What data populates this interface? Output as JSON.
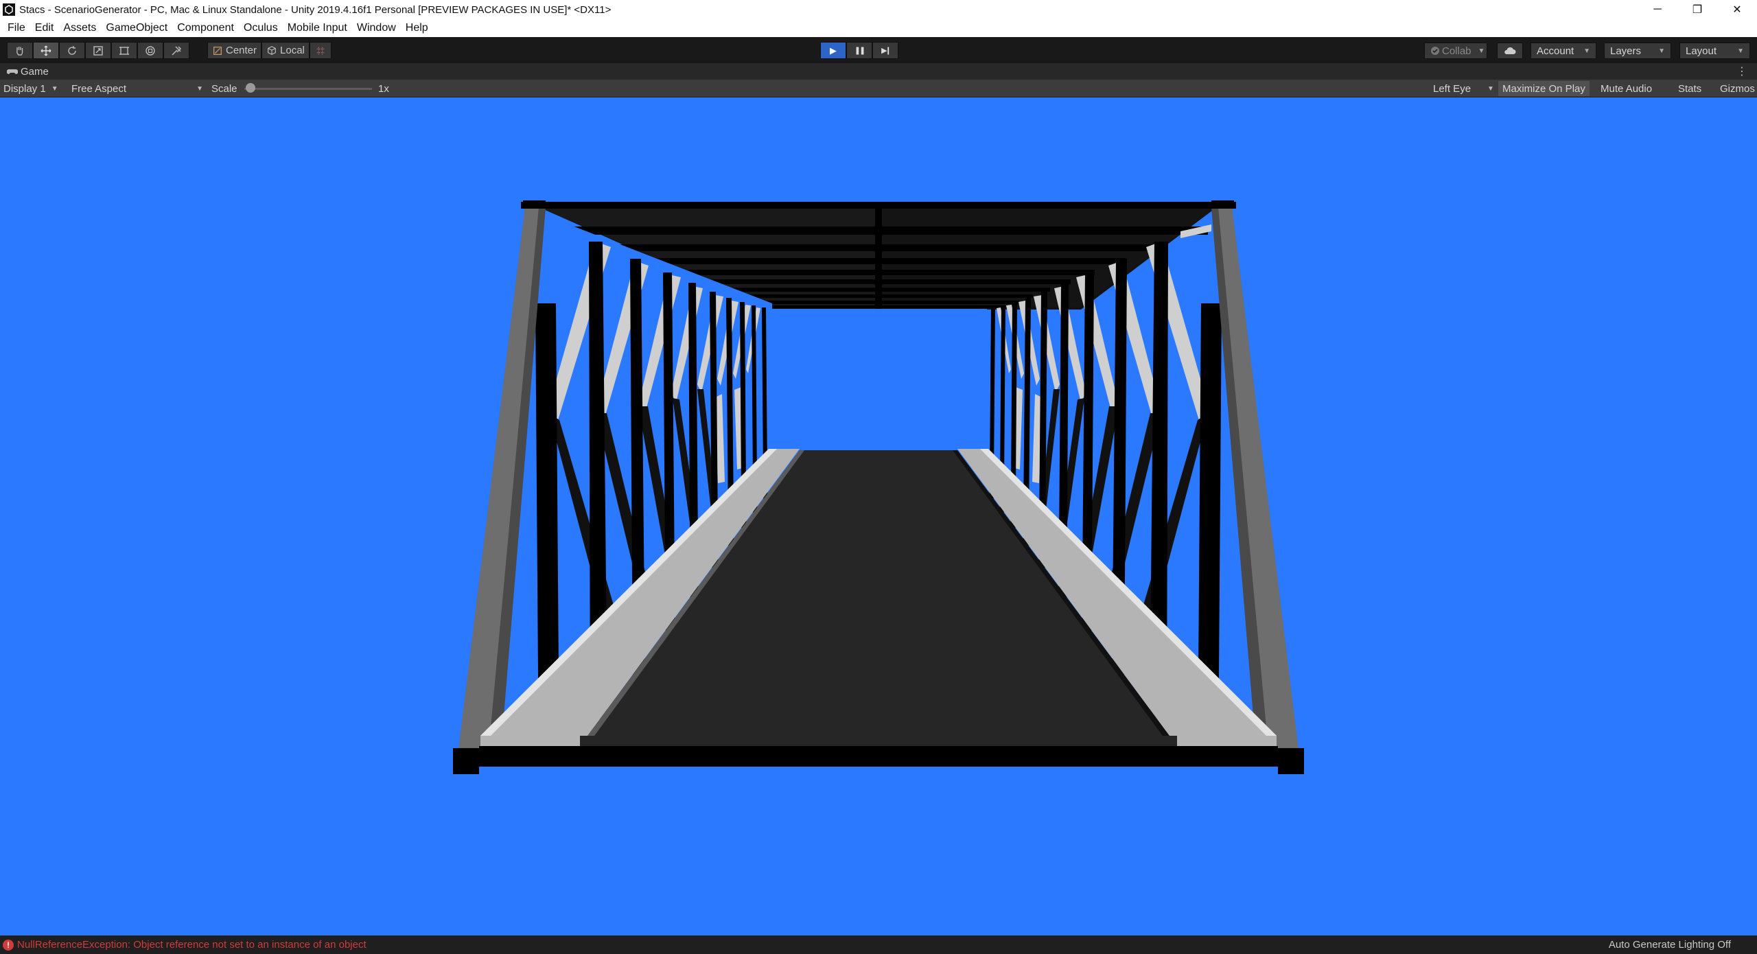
{
  "window": {
    "title": "Stacs - ScenarioGenerator - PC, Mac & Linux Standalone - Unity 2019.4.16f1 Personal [PREVIEW PACKAGES IN USE]* <DX11>",
    "minimize_glyph": "─",
    "restore_glyph": "❐",
    "close_glyph": "✕"
  },
  "menu": {
    "items": [
      "File",
      "Edit",
      "Assets",
      "GameObject",
      "Component",
      "Oculus",
      "Mobile Input",
      "Window",
      "Help"
    ]
  },
  "toolbar": {
    "tools": [
      "hand-tool-icon",
      "move-tool-icon",
      "rotate-tool-icon",
      "scale-tool-icon",
      "rect-tool-icon",
      "transform-tool-icon",
      "custom-tool-icon"
    ],
    "pivot_label": "Center",
    "space_label": "Local",
    "play_glyph": "▶",
    "pause_glyph": "❚❚",
    "step_glyph": "▶❙",
    "collab_label": "Collab",
    "account_label": "Account",
    "layers_label": "Layers",
    "layout_label": "Layout"
  },
  "game_tab": {
    "label": "Game",
    "kebab": "⋮"
  },
  "game_bar": {
    "display": "Display 1",
    "aspect": "Free Aspect",
    "scale_label": "Scale",
    "scale_value": "1x",
    "eye": "Left Eye",
    "maximize_on_play": "Maximize On Play",
    "mute_audio": "Mute Audio",
    "stats": "Stats",
    "gizmos": "Gizmos"
  },
  "status": {
    "error_glyph": "!",
    "error_message": "NullReferenceException: Object reference not set to an instance of an object",
    "lighting": "Auto Generate Lighting Off"
  },
  "colors": {
    "sky": "#2a79ff",
    "deck": "#262626",
    "walkway": "#b4b4b4",
    "steel": "#000000",
    "post": "#6e6e6e",
    "error": "#d13b3b"
  }
}
